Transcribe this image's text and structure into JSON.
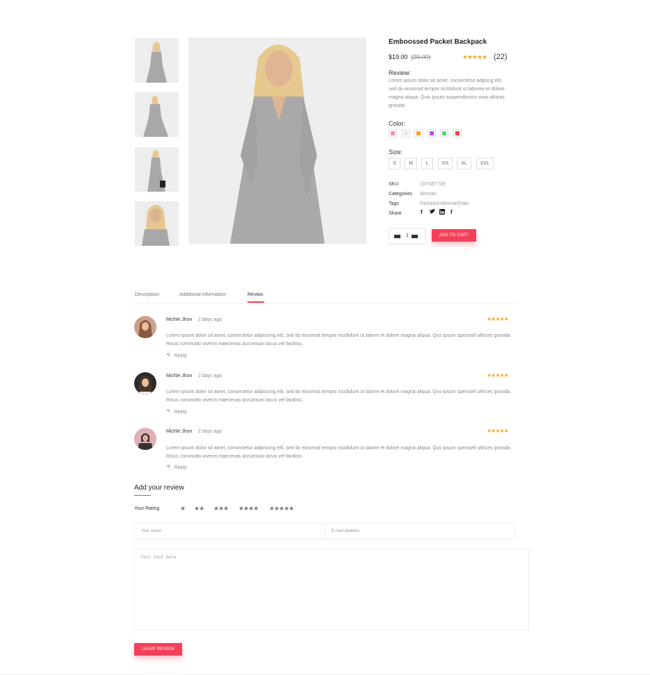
{
  "product": {
    "title": "Emboossed Packet Backpack",
    "price": "$19.00",
    "old_price": "(29.00)",
    "rating_stars": "★★★★★",
    "rating_count": "(22)",
    "review_label": "Review:",
    "review_text": "Lorem ipsum dolor sit amet, consectetur adipscg elit, sed do eiusmod tempor incididunt ut laborea et dolore magna aliqua. Quis ipsum suspendisssm moa ultrices gravida.",
    "color_label": "Color:",
    "colors": [
      "#f28fb5",
      "#e8e8e8",
      "#f5a623",
      "#a855f7",
      "#4ade80",
      "#ef4444"
    ],
    "size_label": "Size:",
    "sizes": [
      "S",
      "M",
      "L",
      "XS",
      "XL",
      "XXL"
    ],
    "meta": {
      "sku_label": "SKU",
      "sku": "11FSE7739",
      "categories_label": "Categories",
      "categories": "Woman",
      "tags_label": "Tags",
      "tags": "Fashion|>Woman|Sale",
      "share_label": "Share"
    },
    "share_icons": [
      "facebook-icon",
      "twitter-icon",
      "linkedin-icon",
      "facebook-icon"
    ],
    "quantity": "1",
    "add_to_cart": "ADD TO CART"
  },
  "tabs": [
    {
      "label": "Description"
    },
    {
      "label": "Additional information"
    },
    {
      "label": "Reviws"
    }
  ],
  "reviews": [
    {
      "name": "Michle Jhon",
      "date": "2 days ago",
      "stars": "★★★★★",
      "text": "Lorem ipsum dolor sit amet, consectetur adipiscing elit, sed do eiusmod tempor incididunt ut labore et dolore magna aliqua. Qus ipsum speisseil ultrices gravida. Risus commodo viverra maecenas accumsan lacus vel facilisis.",
      "reply": "Reply"
    },
    {
      "name": "Michle Jhon",
      "date": "2 days ago",
      "stars": "★★★★★",
      "text": "Lorem ipsum dolor sit amet, consectetur adipiscing elit, sed do eiusmod tempor incididunt ut labore et dolore magna aliqua. Qus ipsum speisseil ultrices gravida. Risus commodo viverra maecenas accumsan lacus vel facilisis.",
      "reply": "Reply"
    },
    {
      "name": "Michle Jhon",
      "date": "2 days ago",
      "stars": "★★★★★",
      "text": "Lorem ipsum dolor sit amet, consectetur adipiscing elit, sed do eiusmod tempor incididunt ut labore et dolore magna aliqua. Qus ipsum speisseil ultrices gravida. Risus commodo viverra maecenas accumsan lacus vel facilisis.",
      "reply": "Reply"
    }
  ],
  "add_review": {
    "title": "Add your review",
    "your_rating": "Your Rating",
    "rating_options": [
      "★",
      "★★",
      "★★★",
      "★★★★",
      "★★★★★"
    ],
    "name_placeholder": "Your name",
    "email_placeholder": "E-mail address",
    "text_placeholder": "Your text here",
    "submit": "LEAVE REVIEW"
  },
  "colors": {
    "accent": "#f2405b",
    "star": "#f0a830"
  }
}
